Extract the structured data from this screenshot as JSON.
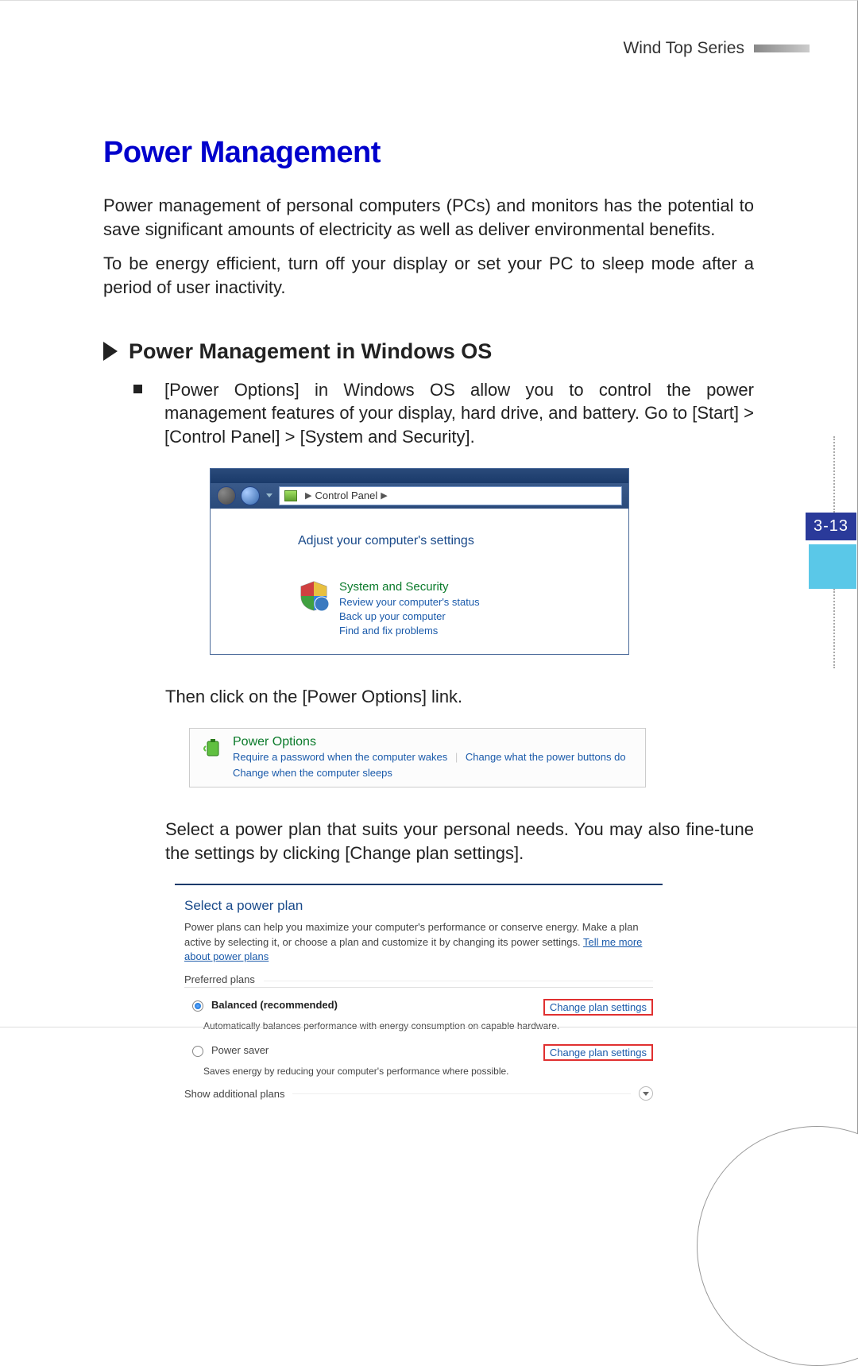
{
  "header": {
    "series": "Wind Top Series"
  },
  "title": "Power Management",
  "intro1": "Power management of personal computers (PCs) and monitors has the potential to save significant amounts of electricity as well as deliver environmental benefits.",
  "intro2": "To be energy efficient, turn off your display or set your PC to sleep mode after a period of user inactivity.",
  "section_heading": "Power Management in Windows OS",
  "bullet1": "[Power Options] in Windows OS allow you to control the power management features of your display, hard drive, and battery. Go to [Start] > [Control Panel] > [System and Security].",
  "shot1": {
    "breadcrumb_item": "Control Panel",
    "body_title": "Adjust your computer's settings",
    "sys_title": "System and Security",
    "link1": "Review your computer's status",
    "link2": "Back up your computer",
    "link3": "Find and fix problems"
  },
  "after_shot1": "Then click on the [Power Options] link.",
  "shot2": {
    "title": "Power Options",
    "link1": "Require a password when the computer wakes",
    "link2": "Change what the power buttons do",
    "link3": "Change when the computer sleeps"
  },
  "after_shot2": "Select a power plan that suits your personal needs. You may also fine-tune the settings by clicking [Change plan settings].",
  "shot3": {
    "title": "Select a power plan",
    "desc_a": "Power plans can help you maximize your computer's performance or conserve energy. Make a plan active by selecting it, or choose a plan and customize it by changing its power settings. ",
    "desc_link": "Tell me more about power plans",
    "legend": "Preferred plans",
    "plan1_name": "Balanced (recommended)",
    "plan1_desc": "Automatically balances performance with energy consumption on capable hardware.",
    "plan2_name": "Power saver",
    "plan2_desc": "Saves energy by reducing your computer's performance where possible.",
    "change": "Change plan settings",
    "show_more": "Show additional plans"
  },
  "page_number": "3-13"
}
